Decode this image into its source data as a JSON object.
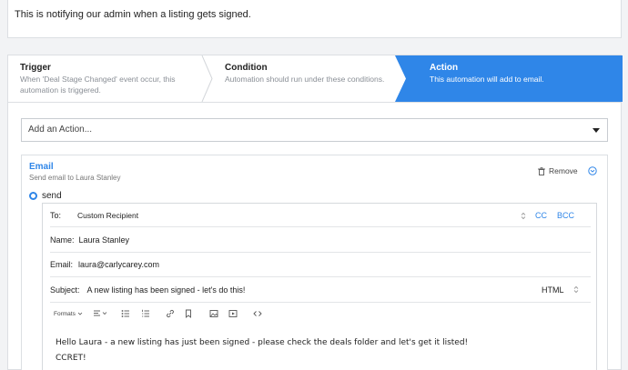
{
  "description": "This is notifying our admin when a listing gets signed.",
  "steps": {
    "trigger": {
      "title": "Trigger",
      "desc_line1": "When 'Deal Stage Changed' event occur, this",
      "desc_line2": "automation is triggered."
    },
    "condition": {
      "title": "Condition",
      "desc": "Automation should run under these conditions."
    },
    "action": {
      "title": "Action",
      "desc": "This automation will add to email."
    }
  },
  "add_action": {
    "placeholder": "Add an Action..."
  },
  "email_action": {
    "title": "Email",
    "subtitle": "Send email to Laura Stanley",
    "remove_label": "Remove",
    "send_label": "send",
    "to_label": "To:",
    "to_value": "Custom Recipient",
    "cc_label": "CC",
    "bcc_label": "BCC",
    "name_label": "Name:",
    "name_value": "Laura Stanley",
    "email_label": "Email:",
    "email_value": "laura@carlycarey.com",
    "subject_label": "Subject:",
    "subject_value": "A new listing has been signed - let's do this!",
    "format_value": "HTML",
    "toolbar": {
      "formats_label": "Formats"
    },
    "body_line1": "Hello Laura - a new listing has just been signed - please check the deals folder and let's get it listed!",
    "body_line2": "CCRET!"
  },
  "colors": {
    "accent": "#2f86e8",
    "border": "#dcdfe3",
    "background": "#f2f3f5"
  },
  "icons": [
    "trash-icon",
    "collapse-circle-icon",
    "radio-selected-icon",
    "select-caret-icon",
    "align-icon",
    "bullet-list-icon",
    "numbered-list-icon",
    "link-icon",
    "bookmark-icon",
    "image-icon",
    "media-icon",
    "code-icon"
  ]
}
